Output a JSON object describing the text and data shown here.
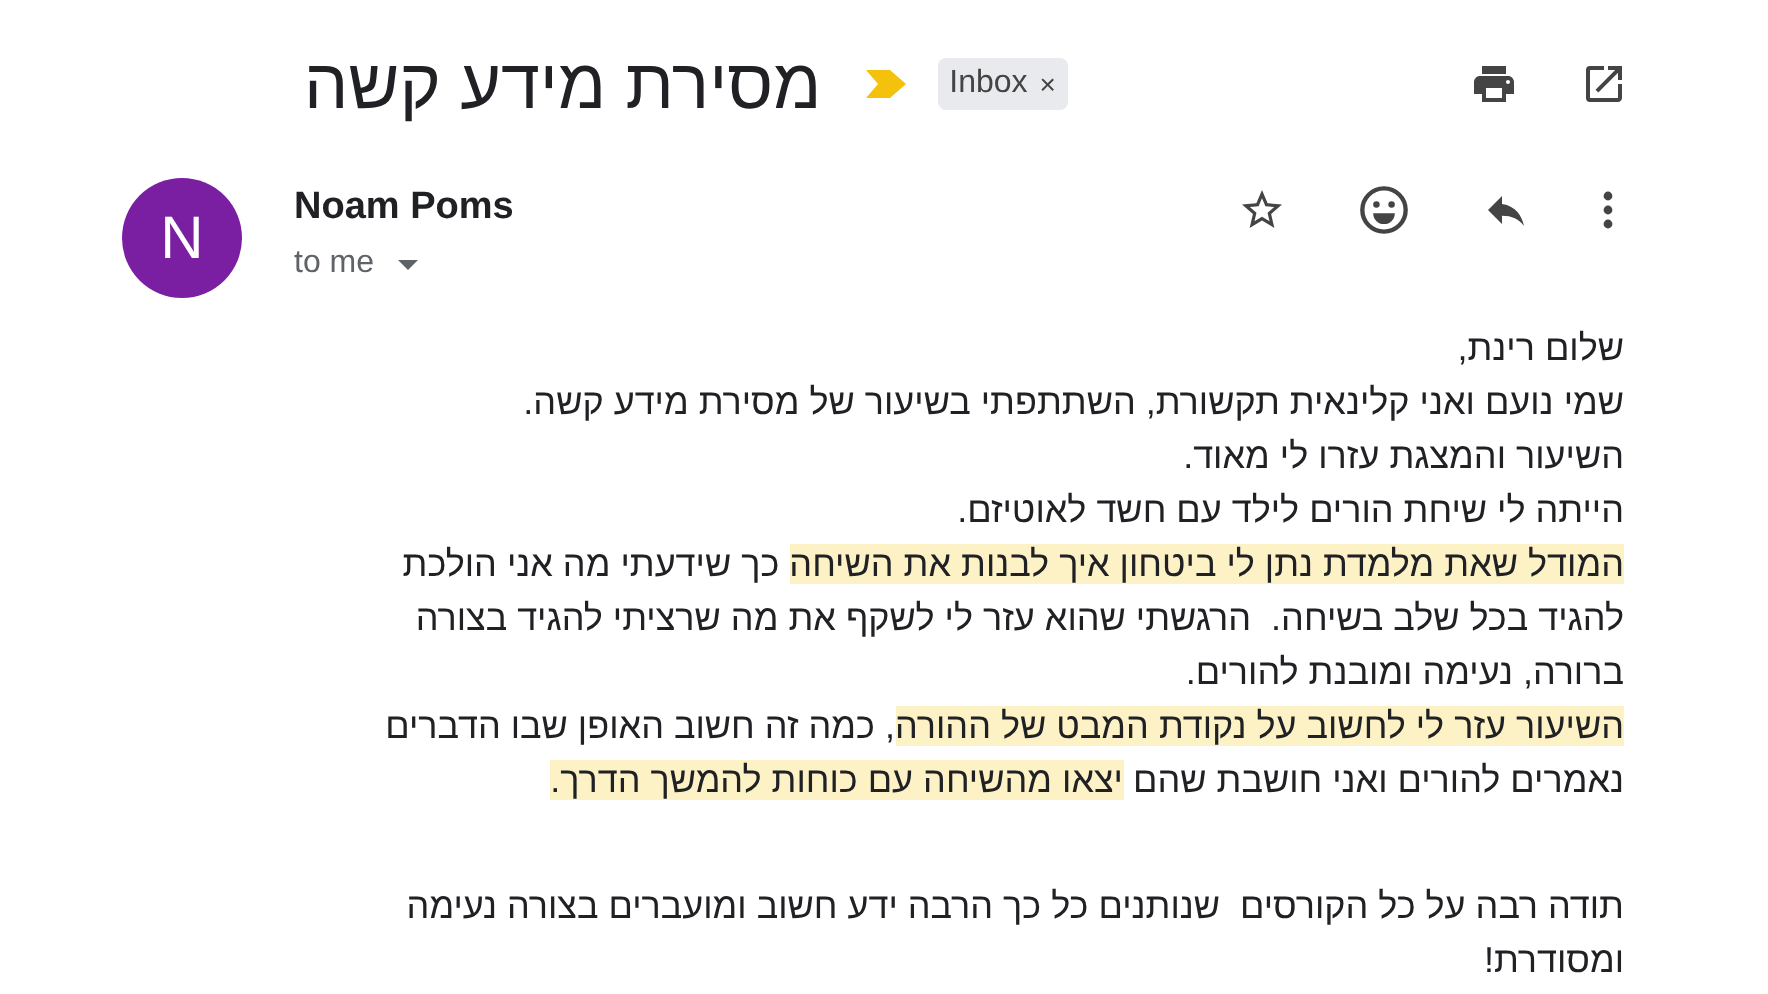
{
  "subject": "מסירת מידע קשה",
  "label": {
    "text": "Inbox",
    "close": "×"
  },
  "sender": {
    "initial": "N",
    "name": "Noam Poms",
    "recipient": "to me"
  },
  "paragraphs": [
    {
      "lines": [
        {
          "segments": [
            {
              "text": "שלום רינת,",
              "highlighted": false
            }
          ]
        },
        {
          "segments": [
            {
              "text": "שמי נועם ואני קלינאית תקשורת, השתתפתי בשיעור של מסירת מידע קשה.",
              "highlighted": false
            }
          ]
        },
        {
          "segments": [
            {
              "text": "השיעור והמצגת עזרו לי מאוד.",
              "highlighted": false
            }
          ]
        },
        {
          "segments": [
            {
              "text": "הייתה לי שיחת הורים לילד עם חשד לאוטיזם.",
              "highlighted": false
            }
          ]
        },
        {
          "segments": [
            {
              "text": "המודל שאת מלמדת נתן לי ביטחון איך לבנות את השיחה",
              "highlighted": true
            },
            {
              "text": " כך שידעתי מה אני הולכת",
              "highlighted": false
            }
          ]
        },
        {
          "segments": [
            {
              "text": "להגיד בכל שלב בשיחה.  הרגשתי שהוא עזר לי לשקף את מה שרציתי להגיד בצורה",
              "highlighted": false
            }
          ]
        },
        {
          "segments": [
            {
              "text": "ברורה, נעימה ומובנת להורים.",
              "highlighted": false
            }
          ]
        },
        {
          "segments": [
            {
              "text": "השיעור עזר לי לחשוב על נקודת המבט של ההורה",
              "highlighted": true
            },
            {
              "text": ", כמה זה חשוב האופן שבו הדברים",
              "highlighted": false
            }
          ]
        },
        {
          "segments": [
            {
              "text": "נאמרים להורים ואני חושבת שהם ",
              "highlighted": false
            },
            {
              "text": "יצאו מהשיחה עם כוחות להמשך הדרך.",
              "highlighted": true
            }
          ]
        }
      ]
    },
    {
      "lines": [
        {
          "segments": [
            {
              "text": "תודה רבה על כל הקורסים  שנותנים כל כך הרבה ידע חשוב ומועברים בצורה נעימה",
              "highlighted": false
            }
          ]
        },
        {
          "segments": [
            {
              "text": "ומסודרת!",
              "highlighted": false
            }
          ]
        }
      ]
    }
  ]
}
